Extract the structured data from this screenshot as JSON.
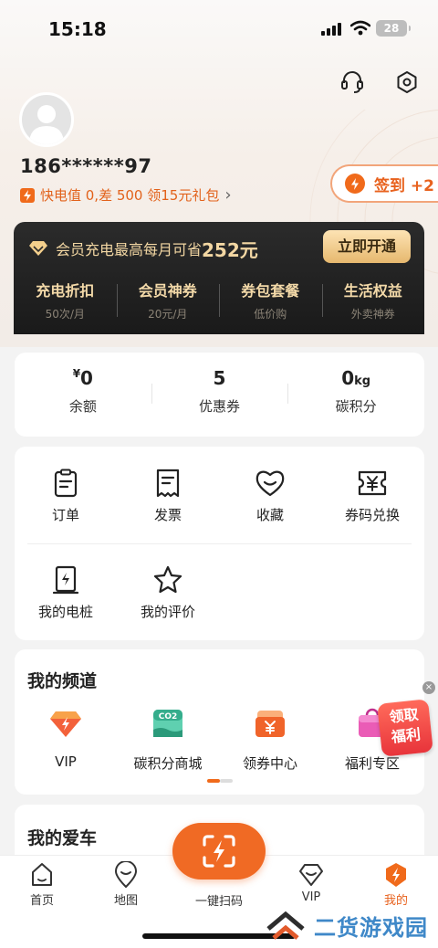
{
  "status_bar": {
    "time": "15:18",
    "battery": "28"
  },
  "profile": {
    "phone": "186******97",
    "gift_text": "快电值 0,差 500 领15元礼包",
    "gift_arrow": "›",
    "checkin_label": "签到 +2"
  },
  "vip_banner": {
    "text": "会员充电最高每月可省",
    "amount": "252元",
    "button": "立即开通",
    "items": [
      {
        "name": "充电折扣",
        "sub": "50次/月"
      },
      {
        "name": "会员神券",
        "sub": "20元/月"
      },
      {
        "name": "券包套餐",
        "sub": "低价购"
      },
      {
        "name": "生活权益",
        "sub": "外卖神券"
      }
    ]
  },
  "stats": [
    {
      "value": "0",
      "prefix": "¥",
      "suffix": "",
      "label": "余额"
    },
    {
      "value": "5",
      "prefix": "",
      "suffix": "",
      "label": "优惠券"
    },
    {
      "value": "0",
      "prefix": "",
      "suffix": "kg",
      "label": "碳积分"
    }
  ],
  "services": [
    {
      "label": "订单",
      "icon": "clipboard-icon"
    },
    {
      "label": "发票",
      "icon": "receipt-icon"
    },
    {
      "label": "收藏",
      "icon": "heart-icon"
    },
    {
      "label": "券码兑换",
      "icon": "coupon-yen-icon"
    },
    {
      "label": "我的电桩",
      "icon": "charging-pile-icon"
    },
    {
      "label": "我的评价",
      "icon": "star-icon"
    }
  ],
  "channels": {
    "title": "我的频道",
    "items": [
      {
        "label": "VIP",
        "icon": "vip-diamond-icon",
        "color": "#f0602a"
      },
      {
        "label": "碳积分商城",
        "icon": "co2-store-icon",
        "color": "#3fbf9a",
        "badge": "CO2"
      },
      {
        "label": "领券中心",
        "icon": "coupon-center-icon",
        "color": "#f06a1b"
      },
      {
        "label": "福利专区",
        "icon": "welfare-bag-icon",
        "color": "#e64cae"
      }
    ],
    "promo": "领取福利",
    "promo_close": "×"
  },
  "car_section": {
    "title": "我的爱车"
  },
  "tabbar": [
    {
      "label": "首页",
      "icon": "home-icon"
    },
    {
      "label": "地图",
      "icon": "map-pin-icon"
    },
    {
      "label": "一键扫码",
      "icon": "scan-icon"
    },
    {
      "label": "VIP",
      "icon": "vip-icon"
    },
    {
      "label": "我的",
      "icon": "profile-bolt-icon"
    }
  ],
  "watermark": "二货游戏园",
  "accent": "#f06a1b"
}
